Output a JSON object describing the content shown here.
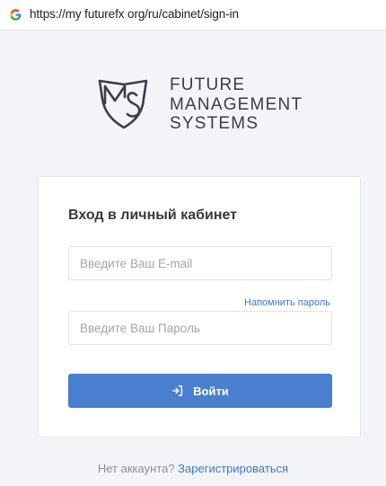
{
  "browser": {
    "url": "https://my futurefx org/ru/cabinet/sign-in",
    "favicon_icon": "google-g-icon"
  },
  "logo": {
    "icon": "shield-ms-logo",
    "lines": [
      "FUTURE",
      "MANAGEMENT",
      "SYSTEMS"
    ]
  },
  "login_form": {
    "title": "Вход в личный кабинет",
    "email_placeholder": "Введите Ваш E-mail",
    "email_value": "",
    "remind_password_label": "Напомнить пароль",
    "password_placeholder": "Введите Ваш Пароль",
    "password_value": "",
    "submit_label": "Войти",
    "submit_icon": "sign-in-icon"
  },
  "footer": {
    "no_account_text": "Нет аккаунта?",
    "register_label": "Зарегистрироваться"
  },
  "colors": {
    "accent": "#4a7fd0",
    "link": "#3a78c3",
    "background": "#f3f4f7"
  }
}
